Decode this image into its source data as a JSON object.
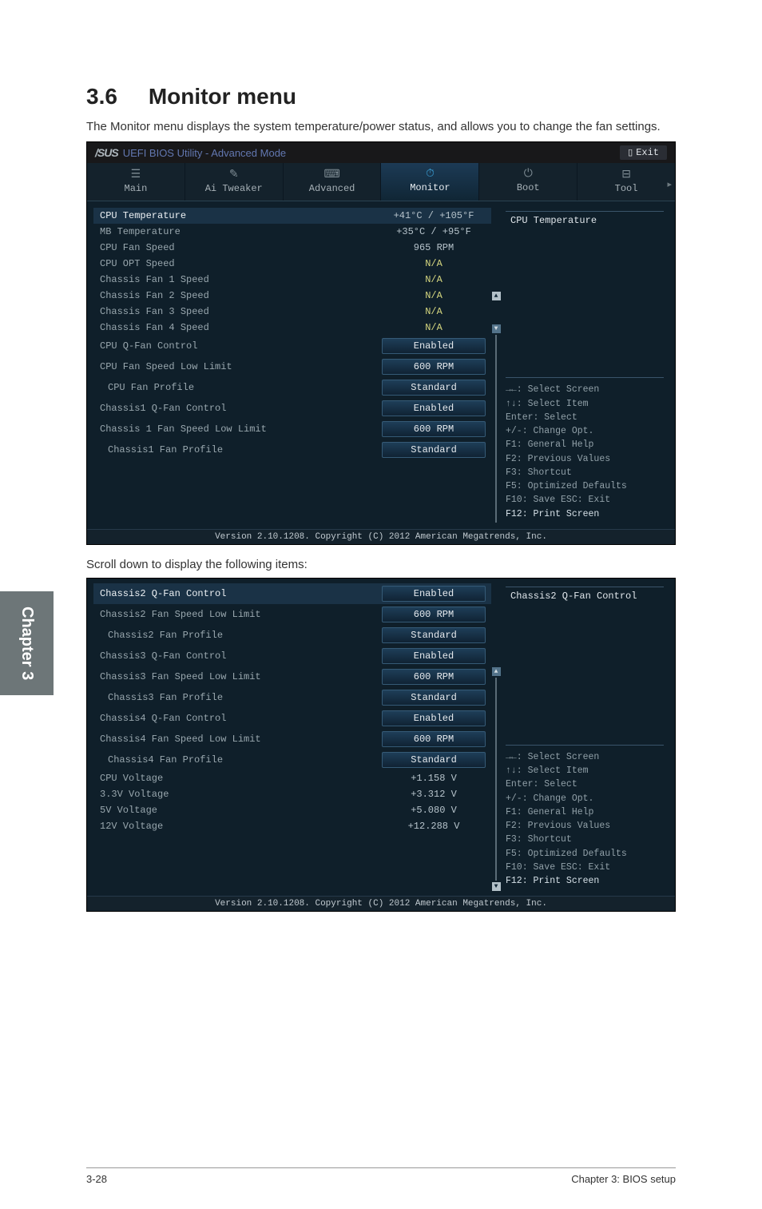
{
  "page": {
    "section_number": "3.6",
    "section_title": "Monitor menu",
    "intro": "The Monitor menu displays the system temperature/power status, and allows you to change the fan settings.",
    "mid_text": "Scroll down to display the following items:",
    "chapter_tab": "Chapter 3",
    "footer_left": "3-28",
    "footer_right": "Chapter 3: BIOS setup"
  },
  "bios": {
    "brand": "/SUS",
    "title": "UEFI BIOS Utility - Advanced Mode",
    "exit_label": "Exit",
    "tabs": [
      {
        "icon": "☰",
        "label": "Main"
      },
      {
        "icon": "✎",
        "label": "Ai Tweaker"
      },
      {
        "icon": "⌨",
        "label": "Advanced"
      },
      {
        "icon": "⏱",
        "label": "Monitor"
      },
      {
        "icon": "⏻",
        "label": "Boot"
      },
      {
        "icon": "⊟",
        "label": "Tool"
      }
    ],
    "active_tab": "Monitor",
    "help_title": "CPU Temperature",
    "help_lines": [
      "→←: Select Screen",
      "↑↓: Select Item",
      "Enter: Select",
      "+/-: Change Opt.",
      "F1: General Help",
      "F2: Previous Values",
      "F3: Shortcut",
      "F5: Optimized Defaults",
      "F10: Save  ESC: Exit",
      "F12: Print Screen"
    ],
    "footer": "Version 2.10.1208. Copyright (C) 2012 American Megatrends, Inc."
  },
  "rows1": [
    {
      "label": "CPU Temperature",
      "value": "+41°C / +105°F",
      "selected": true,
      "pill": false
    },
    {
      "label": "MB Temperature",
      "value": "+35°C / +95°F",
      "pill": false
    },
    {
      "label": "CPU Fan Speed",
      "value": "965 RPM",
      "pill": false
    },
    {
      "label": "CPU OPT Speed",
      "value": "N/A",
      "pill": false,
      "yellow": true
    },
    {
      "label": "Chassis Fan 1 Speed",
      "value": "N/A",
      "pill": false,
      "yellow": true
    },
    {
      "label": "Chassis Fan 2 Speed",
      "value": "N/A",
      "pill": false,
      "yellow": true
    },
    {
      "label": "Chassis Fan 3 Speed",
      "value": "N/A",
      "pill": false,
      "yellow": true
    },
    {
      "label": "Chassis Fan 4 Speed",
      "value": "N/A",
      "pill": false,
      "yellow": true
    },
    {
      "label": "CPU Q-Fan Control",
      "value": "Enabled",
      "pill": true
    },
    {
      "label": "CPU Fan Speed Low Limit",
      "value": "600 RPM",
      "pill": true
    },
    {
      "label": "CPU Fan Profile",
      "value": "Standard",
      "pill": true,
      "indent": true
    },
    {
      "label": "Chassis1 Q-Fan Control",
      "value": "Enabled",
      "pill": true
    },
    {
      "label": "Chassis 1 Fan Speed Low Limit",
      "value": "600 RPM",
      "pill": true
    },
    {
      "label": "Chassis1 Fan Profile",
      "value": "Standard",
      "pill": true,
      "indent": true
    }
  ],
  "bios2": {
    "help_title": "Chassis2 Q-Fan Control"
  },
  "rows2": [
    {
      "label": "Chassis2 Q-Fan Control",
      "value": "Enabled",
      "pill": true,
      "selected": true
    },
    {
      "label": "Chassis2 Fan Speed Low Limit",
      "value": "600 RPM",
      "pill": true
    },
    {
      "label": "Chassis2 Fan Profile",
      "value": "Standard",
      "pill": true,
      "indent": true
    },
    {
      "label": "Chassis3 Q-Fan Control",
      "value": "Enabled",
      "pill": true
    },
    {
      "label": "Chassis3 Fan Speed Low Limit",
      "value": "600 RPM",
      "pill": true
    },
    {
      "label": "Chassis3 Fan Profile",
      "value": "Standard",
      "pill": true,
      "indent": true
    },
    {
      "label": "Chassis4 Q-Fan Control",
      "value": "Enabled",
      "pill": true
    },
    {
      "label": "Chassis4 Fan Speed Low Limit",
      "value": "600 RPM",
      "pill": true
    },
    {
      "label": "Chassis4 Fan Profile",
      "value": "Standard",
      "pill": true,
      "indent": true
    },
    {
      "label": "CPU Voltage",
      "value": "+1.158 V",
      "pill": false
    },
    {
      "label": "3.3V Voltage",
      "value": "+3.312 V",
      "pill": false
    },
    {
      "label": "5V Voltage",
      "value": "+5.080 V",
      "pill": false
    },
    {
      "label": "12V Voltage",
      "value": "+12.288 V",
      "pill": false
    }
  ]
}
